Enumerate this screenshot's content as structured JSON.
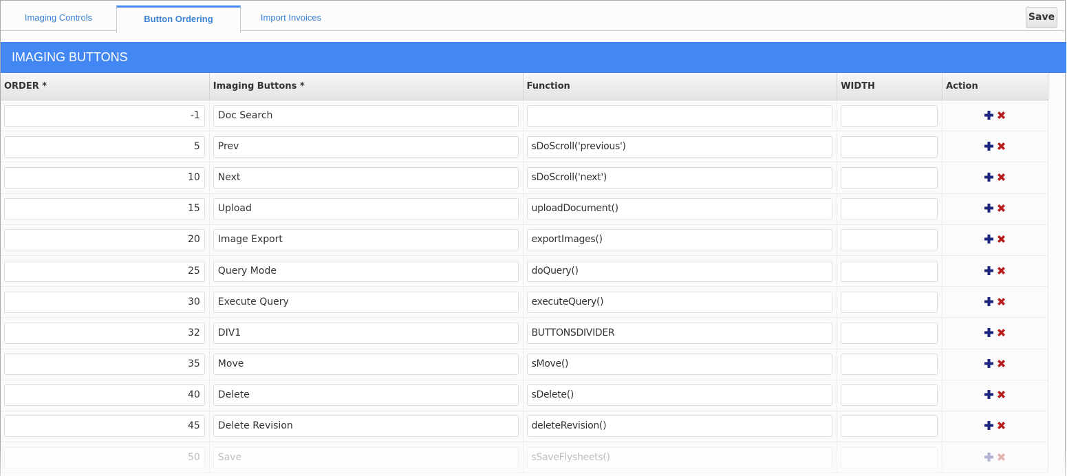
{
  "tabs": [
    {
      "label": "Imaging Controls",
      "active": false
    },
    {
      "label": "Button Ordering",
      "active": true
    },
    {
      "label": "Import Invoices",
      "active": false
    }
  ],
  "toolbar": {
    "save_label": "Save"
  },
  "section": {
    "title": "IMAGING BUTTONS"
  },
  "grid": {
    "columns": [
      "ORDER *",
      "Imaging Buttons *",
      "Function",
      "WIDTH",
      "Action"
    ],
    "rows": [
      {
        "order": "-1",
        "name": "Doc Search",
        "function": "",
        "width": ""
      },
      {
        "order": "5",
        "name": "Prev",
        "function": "sDoScroll('previous')",
        "width": ""
      },
      {
        "order": "10",
        "name": "Next",
        "function": "sDoScroll('next')",
        "width": ""
      },
      {
        "order": "15",
        "name": "Upload",
        "function": "uploadDocument()",
        "width": ""
      },
      {
        "order": "20",
        "name": "Image Export",
        "function": "exportImages()",
        "width": ""
      },
      {
        "order": "25",
        "name": "Query Mode",
        "function": "doQuery()",
        "width": ""
      },
      {
        "order": "30",
        "name": "Execute Query",
        "function": "executeQuery()",
        "width": ""
      },
      {
        "order": "32",
        "name": "DIV1",
        "function": "BUTTONSDIVIDER",
        "width": ""
      },
      {
        "order": "35",
        "name": "Move",
        "function": "sMove()",
        "width": ""
      },
      {
        "order": "40",
        "name": "Delete",
        "function": "sDelete()",
        "width": ""
      },
      {
        "order": "45",
        "name": "Delete Revision",
        "function": "deleteRevision()",
        "width": ""
      },
      {
        "order": "50",
        "name": "Save",
        "function": "sSaveFlysheets()",
        "width": ""
      }
    ],
    "actions": {
      "add_icon": "plus-icon",
      "remove_icon": "x-icon"
    }
  },
  "colors": {
    "accent": "#4387f4",
    "tab_text": "#3b82d6",
    "add_icon": "#1a237e",
    "remove_icon": "#b71c1c"
  }
}
